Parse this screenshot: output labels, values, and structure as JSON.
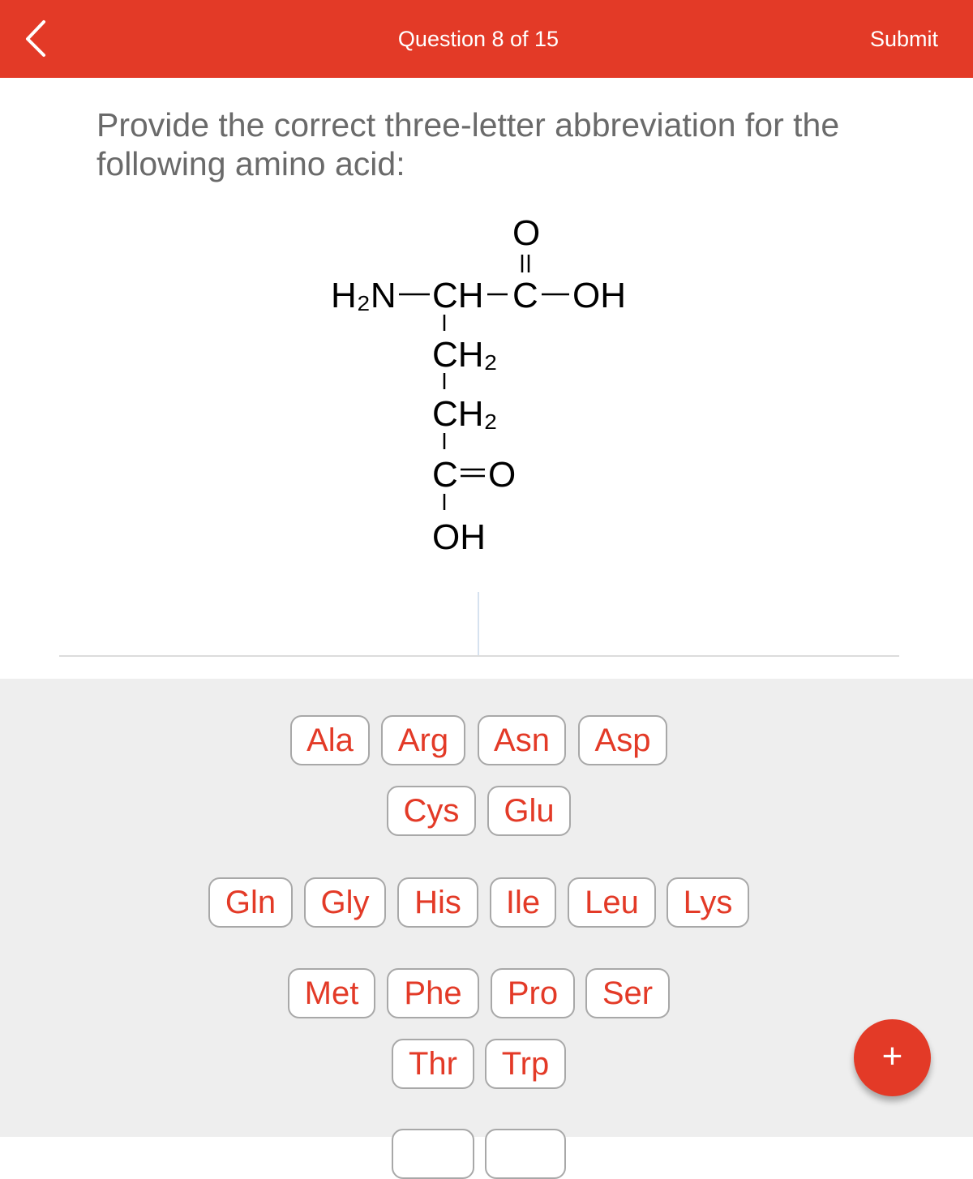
{
  "header": {
    "title": "Question 8 of 15",
    "submit_label": "Submit",
    "back_icon": "chevron-left-icon"
  },
  "question": {
    "prompt": "Provide the correct three-letter abbreviation for the following amino acid:"
  },
  "molecule": {
    "name": "glutamic acid structure",
    "atoms": {
      "amine": "H₂N",
      "alpha_ch": "CH",
      "carboxyl_c": "C",
      "carboxyl_o": "O",
      "carboxyl_oh": "OH",
      "ch2_1": "CH₂",
      "ch2_2": "CH₂",
      "side_c": "C",
      "side_o": "O",
      "side_oh": "OH"
    }
  },
  "answer": {
    "value": ""
  },
  "keyboard": {
    "keys": [
      "Ala",
      "Arg",
      "Asn",
      "Asp",
      "Cys",
      "Glu",
      "Gln",
      "Gly",
      "His",
      "Ile",
      "Leu",
      "Lys",
      "Met",
      "Phe",
      "Pro",
      "Ser",
      "Thr",
      "Trp"
    ]
  },
  "fab": {
    "label": "+",
    "icon": "plus-icon"
  },
  "colors": {
    "accent": "#e33a27",
    "keyboard_bg": "#eeeeee",
    "prompt_text": "#6a6a6a"
  }
}
